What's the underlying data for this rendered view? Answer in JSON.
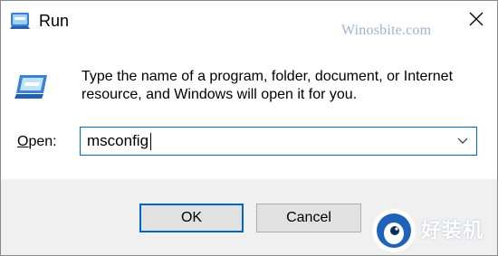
{
  "window": {
    "title": "Run",
    "icon": "run-icon",
    "close_icon": "close-icon"
  },
  "watermark": {
    "text": "Winosbite.com",
    "badge_text": "好装机",
    "badge_icon": "penguin-logo-icon"
  },
  "body": {
    "icon": "run-program-icon",
    "description": "Type the name of a program, folder, document, or Internet resource, and Windows will open it for you."
  },
  "open_field": {
    "label_accel": "O",
    "label_rest": "pen:",
    "value": "msconfig",
    "dropdown_icon": "chevron-down-icon"
  },
  "buttons": {
    "ok_label": "OK",
    "cancel_label": "Cancel"
  },
  "colors": {
    "accent": "#0067c0",
    "footer_bg": "#f0f0f0",
    "button_bg": "#e1e1e1",
    "watermark": "#9fb2d6"
  }
}
